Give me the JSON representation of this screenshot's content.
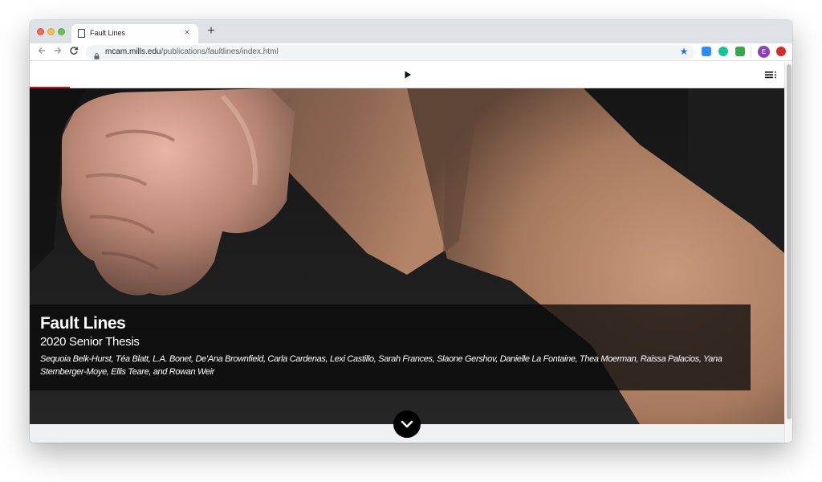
{
  "browser": {
    "tab_title": "Fault Lines",
    "tab_close": "×",
    "new_tab": "+",
    "url_host": "mcam.mills.edu",
    "url_path": "/publications/faultlines/index.html",
    "profile_initial": "E",
    "icons": [
      "back-arrow-icon",
      "forward-arrow-icon",
      "reload-icon",
      "lock-icon",
      "star-icon",
      "zoom-extension-icon",
      "grammarly-extension-icon",
      "extension-icon",
      "lastpass-extension-icon"
    ]
  },
  "page": {
    "reading_progress": 0.053,
    "hero": {
      "title": "Fault Lines",
      "subtitle": "2020 Senior Thesis",
      "credits": "Sequoia Belk-Hurst, Téa Blatt, L.A. Bonet, De’Ana Brownfield, Carla Cardenas, Lexi Castillo, Sarah Frances, Slaone Gershov, Danielle La Fontaine, Thea Moerman, Raissa Palacios, Yana Sternberger-Moye, Ellis Teare, and Rowan Weir"
    },
    "accent_color": "#c8102e"
  }
}
